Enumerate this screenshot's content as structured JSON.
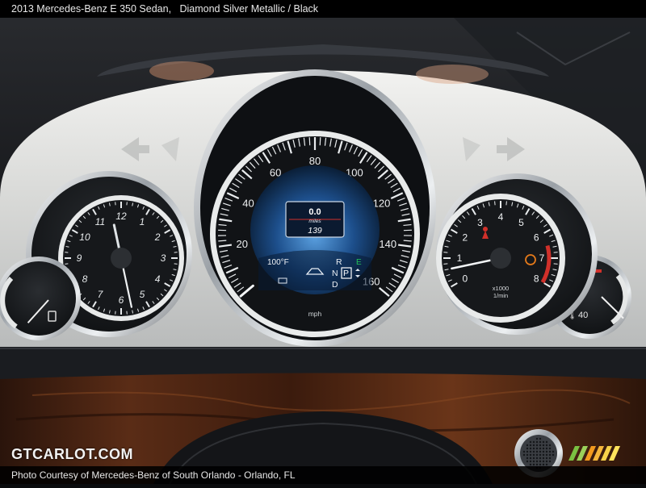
{
  "caption": {
    "title": "2013 Mercedes-Benz E 350 Sedan,",
    "color_spec": "Diamond Silver Metallic / Black"
  },
  "speedometer": {
    "ticks": [
      "20",
      "40",
      "60",
      "80",
      "100",
      "120",
      "140",
      "160"
    ],
    "unit": "mph",
    "needle_value_mph": 0
  },
  "display": {
    "trip_value": "0.0",
    "trip_unit": "miles",
    "odometer": "139",
    "temperature": "100°F",
    "gears": [
      "R",
      "N",
      "P",
      "D"
    ],
    "eco_letter": "E"
  },
  "clock": {
    "numbers": [
      "12",
      "1",
      "2",
      "3",
      "4",
      "5",
      "6",
      "7",
      "8",
      "9",
      "10",
      "11"
    ],
    "hour_value": 11.6,
    "minute_value": 28
  },
  "tachometer": {
    "ticks": [
      "0",
      "1",
      "2",
      "3",
      "4",
      "5",
      "6",
      "7",
      "8"
    ],
    "scale_label": "x1000",
    "unit_label": "1/min",
    "needle_value": 0.6
  },
  "fuel_gauge": {
    "level_fraction": 0.1
  },
  "temp_gauge": {
    "tick": "40",
    "level_fraction": 0.15
  },
  "watermark": {
    "logo": "GTCARLOT.COM",
    "photo_credit": "Photo Courtesy of Mercedes-Benz of South Orlando - Orlando, FL"
  },
  "colors": {
    "accent_red": "#d0302a",
    "display_blue": "#3b7fc8",
    "eco_green": "#22c35a",
    "badge_green": "#7ac142",
    "badge_orange": "#f39a1e"
  }
}
